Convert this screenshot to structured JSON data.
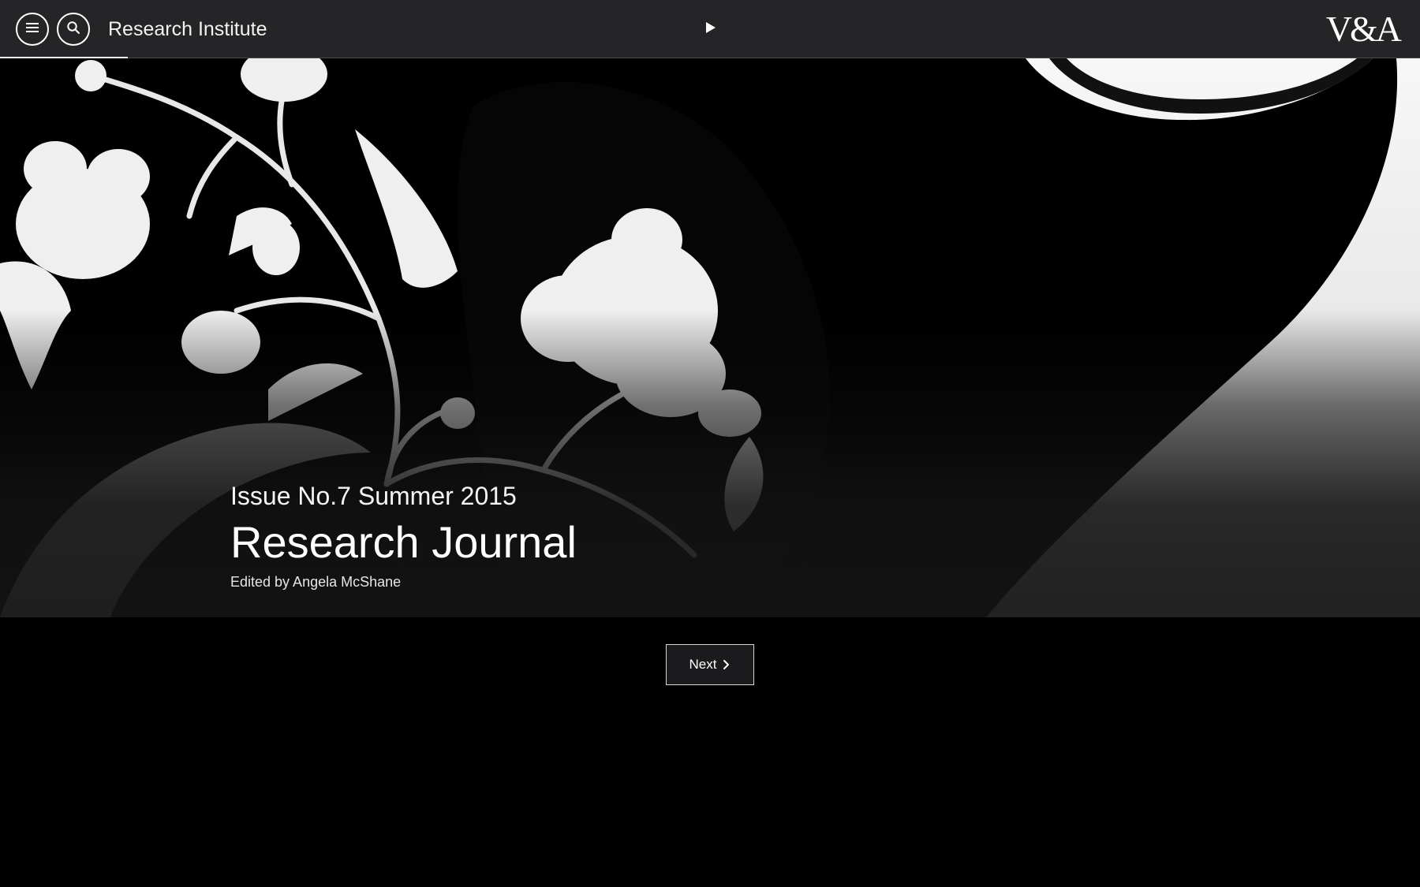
{
  "header": {
    "menu_icon": "hamburger-menu-icon",
    "search_icon": "search-icon",
    "site_title": "Research Institute",
    "play_icon": "play-icon",
    "logo_text": "V&A",
    "progress_fraction": 0.09
  },
  "hero": {
    "issue": "Issue No.7 Summer 2015",
    "title": "Research Journal",
    "editor": "Edited by Angela McShane"
  },
  "pager": {
    "next_label": "Next",
    "next_icon": "chevron-right-icon"
  },
  "colors": {
    "topbar_bg": "#252527",
    "page_bg": "#000000",
    "text": "#ffffff"
  }
}
